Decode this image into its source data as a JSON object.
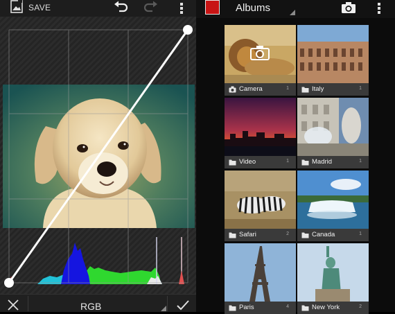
{
  "editor": {
    "save_label": "SAVE",
    "channel_label": "RGB",
    "icons": [
      "save-icon",
      "undo-icon",
      "redo-icon",
      "overflow-menu-icon",
      "cancel-icon",
      "checkmark-icon"
    ]
  },
  "gallery": {
    "title": "Albums",
    "accent_color": "#c81414",
    "albums": [
      {
        "name": "Camera",
        "count": "1",
        "icon": "camera-icon"
      },
      {
        "name": "Italy",
        "count": "1",
        "icon": "folder-icon"
      },
      {
        "name": "Video",
        "count": "1",
        "icon": "folder-icon"
      },
      {
        "name": "Madrid",
        "count": "1",
        "icon": "folder-icon"
      },
      {
        "name": "Safari",
        "count": "2",
        "icon": "folder-icon"
      },
      {
        "name": "Canada",
        "count": "1",
        "icon": "folder-icon"
      },
      {
        "name": "Paris",
        "count": "4",
        "icon": "folder-icon"
      },
      {
        "name": "New York",
        "count": "2",
        "icon": "folder-icon"
      }
    ]
  }
}
